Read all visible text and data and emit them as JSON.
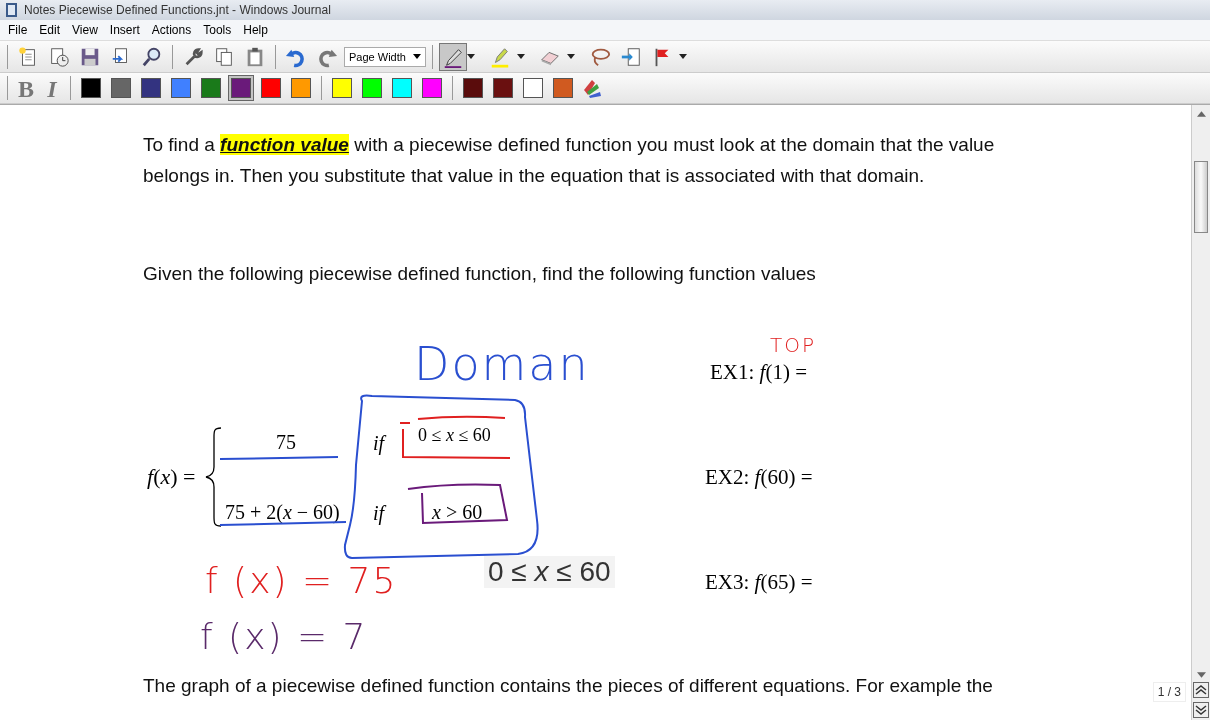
{
  "window": {
    "title": "Notes Piecewise Defined Functions.jnt - Windows Journal"
  },
  "menu": [
    "File",
    "Edit",
    "View",
    "Insert",
    "Actions",
    "Tools",
    "Help"
  ],
  "toolbar": {
    "groups": [
      [
        {
          "kind": "new",
          "selected": false
        },
        {
          "kind": "recent",
          "selected": false
        },
        {
          "kind": "save",
          "selected": false
        },
        {
          "kind": "send",
          "selected": false
        },
        {
          "kind": "find",
          "selected": false
        }
      ],
      [
        {
          "kind": "tools",
          "selected": false
        },
        {
          "kind": "copy",
          "selected": false
        },
        {
          "kind": "paste",
          "selected": false
        }
      ],
      [
        {
          "kind": "undo",
          "selected": false
        },
        {
          "kind": "redo",
          "selected": false
        }
      ]
    ],
    "zoom": "Page Width",
    "pen_tools": [
      {
        "kind": "pen",
        "selected": true,
        "has_menu": true
      },
      {
        "kind": "highlighter",
        "selected": false,
        "has_menu": true
      },
      {
        "kind": "eraser",
        "selected": false,
        "has_menu": true
      },
      {
        "kind": "lasso",
        "selected": false,
        "has_menu": false
      },
      {
        "kind": "insert-space",
        "selected": false,
        "has_menu": false
      },
      {
        "kind": "flag",
        "selected": false,
        "has_menu": true
      }
    ]
  },
  "format": {
    "bold": "B",
    "italic": "I"
  },
  "palette": {
    "groups": [
      [
        {
          "color": "#000000",
          "selected": false
        },
        {
          "color": "#666666",
          "selected": false
        },
        {
          "color": "#333380",
          "selected": false
        },
        {
          "color": "#4080ff",
          "selected": false
        },
        {
          "color": "#1a7a1a",
          "selected": false
        },
        {
          "color": "#6a1a7a",
          "selected": true
        },
        {
          "color": "#ff0000",
          "selected": false
        },
        {
          "color": "#ff9900",
          "selected": false
        }
      ],
      [
        {
          "color": "#ffff00",
          "selected": false
        },
        {
          "color": "#00ff00",
          "selected": false
        },
        {
          "color": "#00ffff",
          "selected": false
        },
        {
          "color": "#ff00ff",
          "selected": false
        }
      ],
      [
        {
          "color": "#5a0c0c",
          "selected": false
        },
        {
          "color": "#6a1010",
          "selected": false
        },
        {
          "color": "#ffffff",
          "selected": false
        },
        {
          "color": "#d05a20",
          "selected": false
        }
      ]
    ]
  },
  "page": {
    "intro": {
      "before": "To find a",
      "highlight": "function value",
      "after": "with a piecewise defined function you must look at the domain that the value belongs in.  Then you substitute that value in the equation that is associated with that domain."
    },
    "prompt": "Given the following piecewise defined function, find the following function values",
    "function": {
      "lhs": "*f*(*x*) =",
      "rows": [
        {
          "expr": "75",
          "cond_word": "if",
          "cond": "0 ≤ *x* ≤ 60"
        },
        {
          "expr": "75 + 2(*x* − 60)",
          "cond_word": "if",
          "cond": "*x* > 60"
        }
      ]
    },
    "pasted": "0 ≤ *x* ≤ 60",
    "examples": [
      "EX1:  *f*(1) =",
      "EX2:  *f*(60) =",
      "EX3:  *f*(65) ="
    ],
    "ink": [
      {
        "text": "TOP",
        "color": "#e02020"
      },
      {
        "text": "Doman",
        "color": "#2a4fd0"
      },
      {
        "text": "f (x) = 75",
        "color": "#e02020"
      },
      {
        "text": "f (x) = 7",
        "color": "#5a2a6a"
      }
    ],
    "outro": "The graph of a piecewise defined function contains the pieces of different equations.  For example the"
  },
  "page_indicator": "1 / 3"
}
